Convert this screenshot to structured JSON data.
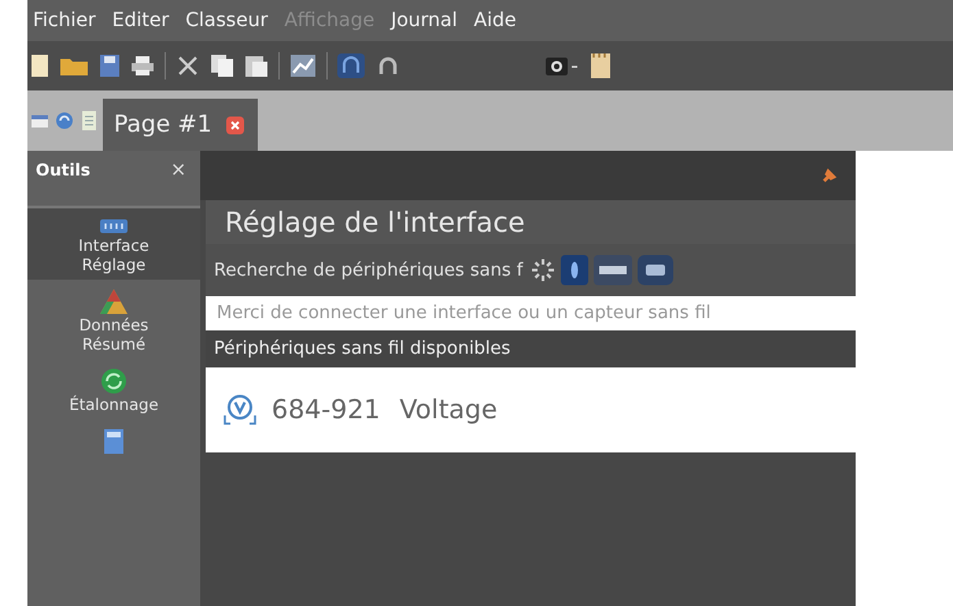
{
  "menu": [
    {
      "label": "Fichier",
      "disabled": false
    },
    {
      "label": "Editer",
      "disabled": false
    },
    {
      "label": "Classeur",
      "disabled": false
    },
    {
      "label": "Affichage",
      "disabled": true
    },
    {
      "label": "Journal",
      "disabled": false
    },
    {
      "label": "Aide",
      "disabled": false
    }
  ],
  "tabs": [
    {
      "label": "Page  #1",
      "selected": true
    }
  ],
  "sidebar": {
    "title": "Outils",
    "close": "×",
    "items": [
      {
        "kind": "interface",
        "lines": [
          "Interface",
          "Réglage"
        ],
        "selected": true
      },
      {
        "kind": "data",
        "lines": [
          "Données",
          "Résumé"
        ],
        "selected": false
      },
      {
        "kind": "calibration",
        "lines": [
          "Étalonnage"
        ],
        "selected": false
      },
      {
        "kind": "page",
        "selected": false
      }
    ]
  },
  "panel": {
    "title": "Réglage de l'interface",
    "search_status": "Recherche de périphériques sans f",
    "message": "Merci de connecter une interface ou un capteur sans fil",
    "list_header": "Périphériques sans fil disponibles",
    "devices": [
      {
        "id": "684-921",
        "name": "Voltage"
      }
    ]
  }
}
